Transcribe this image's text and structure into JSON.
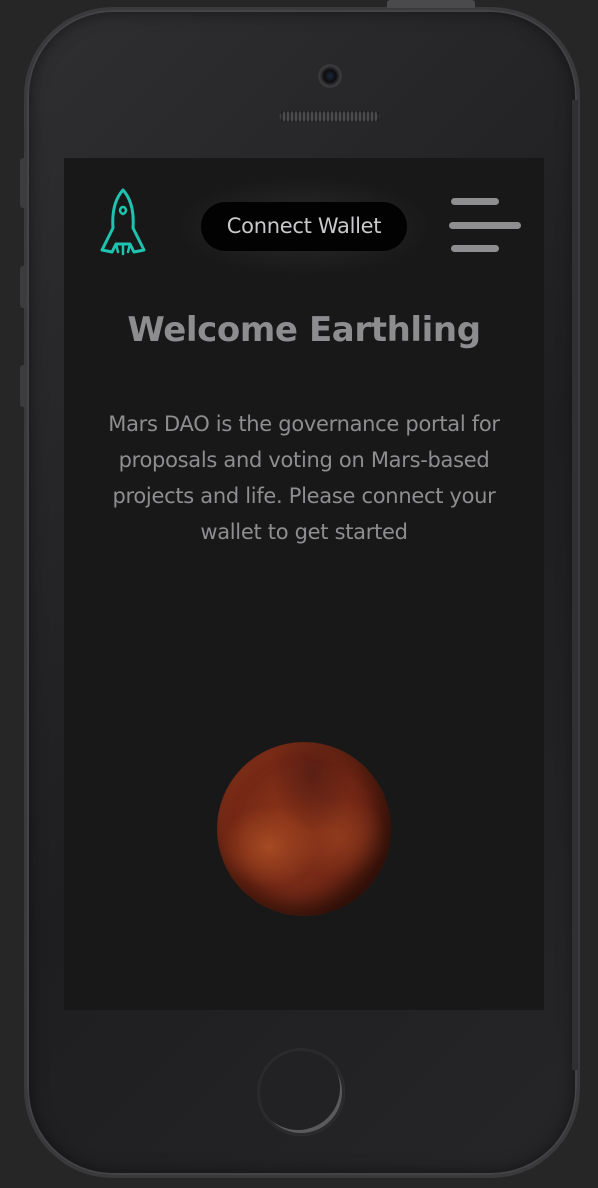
{
  "header": {
    "logo_icon": "rocket-icon",
    "connect_wallet_label": "Connect Wallet",
    "menu_icon": "hamburger-menu-icon"
  },
  "main": {
    "title": "Welcome Earthling",
    "description": "Mars DAO is the governance portal for proposals and voting on Mars-based projects and life. Please connect your wallet to get started",
    "hero_image": "mars-planet"
  },
  "colors": {
    "background": "#181818",
    "logo_accent": "#1fc4b0",
    "text": "#8e8e91",
    "button_bg": "#020202",
    "button_text": "#c9c9cc"
  }
}
